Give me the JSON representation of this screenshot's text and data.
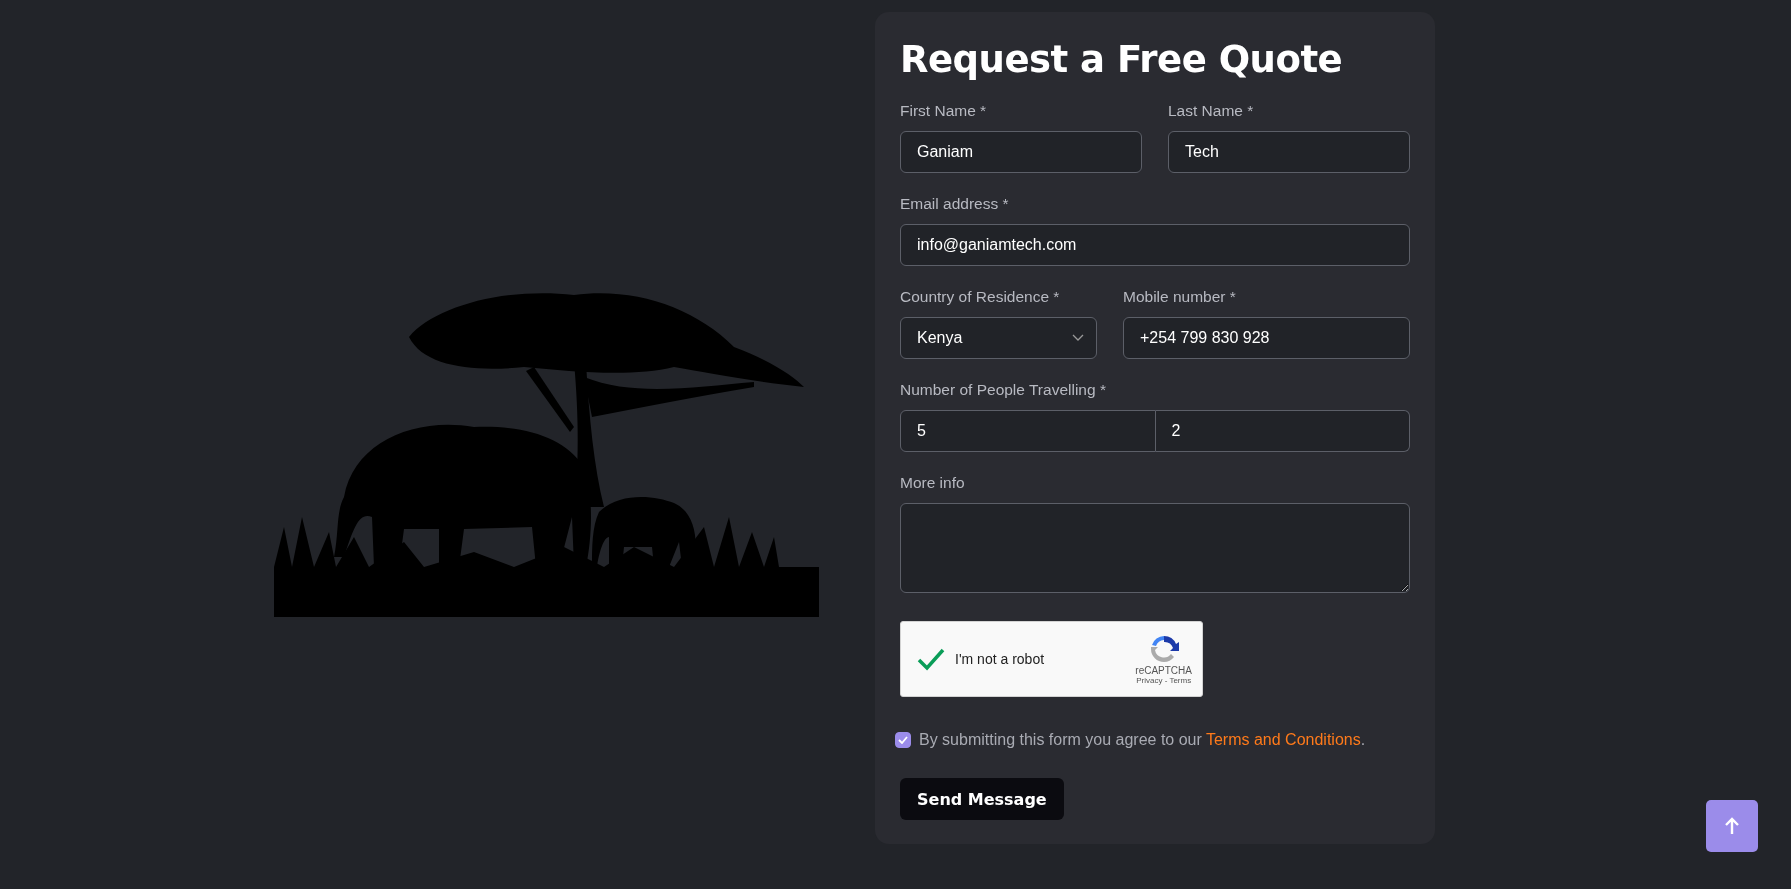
{
  "form": {
    "title": "Request a Free Quote",
    "first_name": {
      "label": "First Name *",
      "value": "Ganiam"
    },
    "last_name": {
      "label": "Last Name *",
      "value": "Tech"
    },
    "email": {
      "label": "Email address *",
      "value": "info@ganiamtech.com"
    },
    "country": {
      "label": "Country of Residence *",
      "value": "Kenya"
    },
    "mobile": {
      "label": "Mobile number *",
      "value": "+254 799 830 928"
    },
    "people": {
      "label": "Number of People Travelling *",
      "values": [
        "5",
        "2"
      ]
    },
    "more_info": {
      "label": "More info"
    },
    "captcha": {
      "checked": true,
      "label": "I'm not a robot",
      "brand": "reCAPTCHA",
      "links": [
        "Privacy",
        "Terms"
      ],
      "separator": "-"
    },
    "agreement": {
      "checked": true,
      "text": "By submitting this form you agree to our ",
      "link": "Terms and Conditions",
      "end": "."
    },
    "submit": "Send Message"
  }
}
